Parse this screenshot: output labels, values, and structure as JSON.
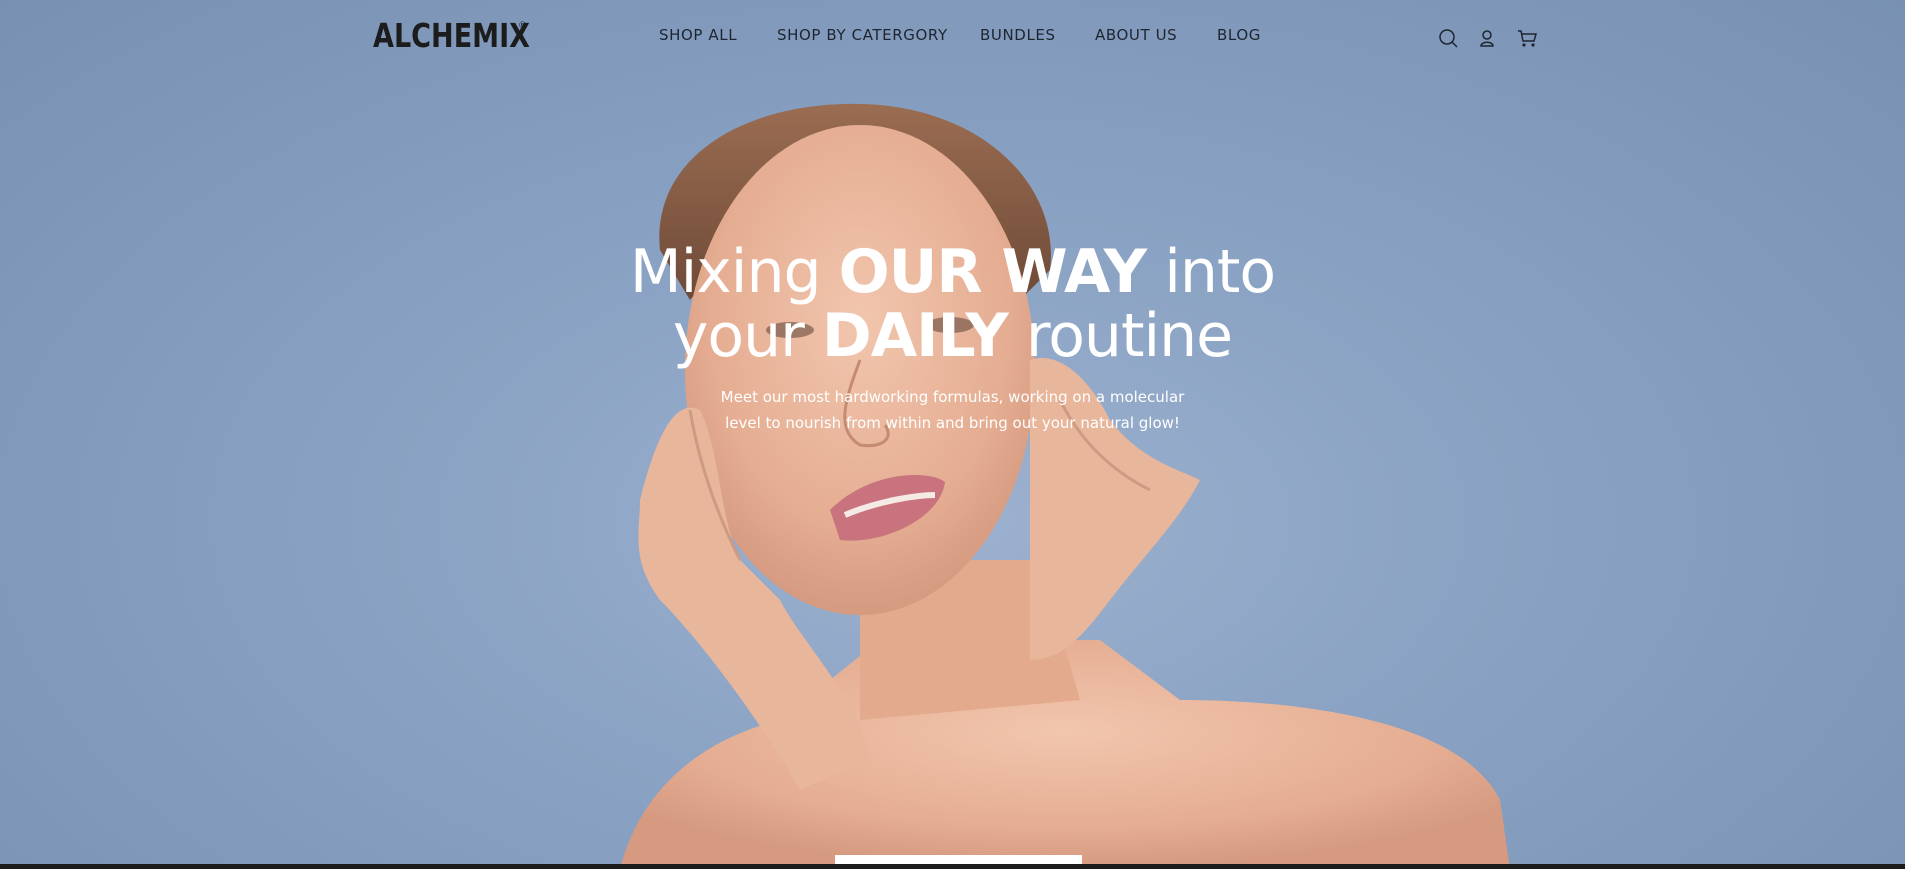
{
  "brand": {
    "logo_text": "ALCHEMIX",
    "registered_mark": "®"
  },
  "nav": {
    "items": [
      {
        "label": "SHOP ALL"
      },
      {
        "label": "SHOP BY CATERGORY"
      },
      {
        "label": "BUNDLES"
      },
      {
        "label": "ABOUT US"
      },
      {
        "label": "BLOG"
      }
    ]
  },
  "header_icons": [
    "search-icon",
    "account-icon",
    "cart-icon"
  ],
  "hero": {
    "line1_a": "Mixing ",
    "line1_b": "OUR WAY",
    "line1_c": " into",
    "line2_a": "your ",
    "line2_b": "DAILY",
    "line2_c": " routine",
    "sub_line1": "Meet our most hardworking formulas, working on a molecular",
    "sub_line2": "level to nourish from within and bring out your natural glow!"
  },
  "colors": {
    "background": "#8aa2c3",
    "text_dark": "#1f2530",
    "hero_text": "#ffffff",
    "skin": "#e9b9a0"
  }
}
